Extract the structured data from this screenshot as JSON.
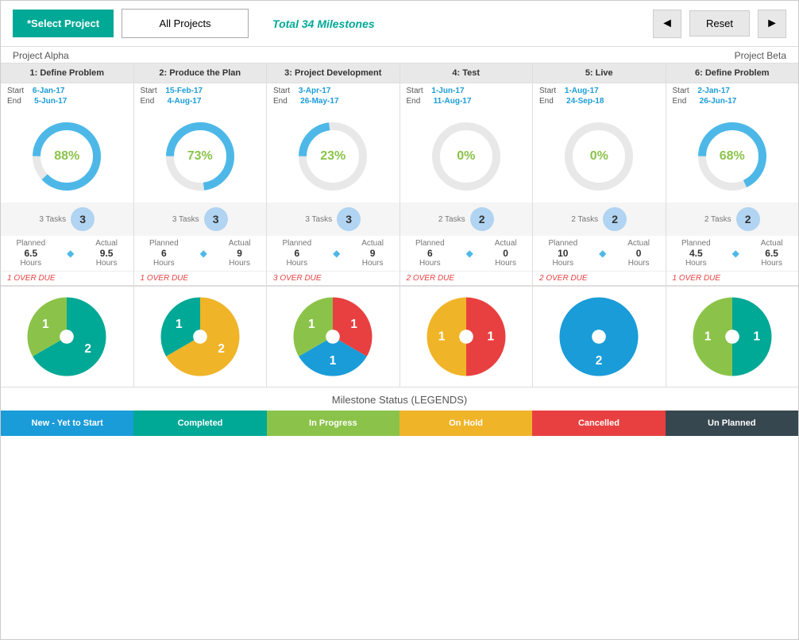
{
  "header": {
    "select_label": "*Select Project",
    "all_projects_label": "All Projects",
    "total_milestones": "Total 34 Milestones",
    "reset_label": "Reset",
    "prev_icon": "◄",
    "next_icon": "►"
  },
  "project_labels": {
    "left": "Project Alpha",
    "right": "Project Beta"
  },
  "phases": [
    {
      "id": 1,
      "name": "1: Define Problem",
      "start": "6-Jan-17",
      "end": "5-Jun-17",
      "percent": "88%",
      "pct_value": 88,
      "tasks": "3 Tasks",
      "tasks_count": "3",
      "planned_hours": "6.5",
      "actual_hours": "9.5",
      "overdue": "1 OVER DUE"
    },
    {
      "id": 2,
      "name": "2: Produce the Plan",
      "start": "15-Feb-17",
      "end": "4-Aug-17",
      "percent": "73%",
      "pct_value": 73,
      "tasks": "3 Tasks",
      "tasks_count": "3",
      "planned_hours": "6",
      "actual_hours": "9",
      "overdue": "1 OVER DUE"
    },
    {
      "id": 3,
      "name": "3: Project Development",
      "start": "3-Apr-17",
      "end": "26-May-17",
      "percent": "23%",
      "pct_value": 23,
      "tasks": "3 Tasks",
      "tasks_count": "3",
      "planned_hours": "6",
      "actual_hours": "9",
      "overdue": "3 OVER DUE"
    },
    {
      "id": 4,
      "name": "4: Test",
      "start": "1-Jun-17",
      "end": "11-Aug-17",
      "percent": "0%",
      "pct_value": 0,
      "tasks": "2 Tasks",
      "tasks_count": "2",
      "planned_hours": "6",
      "actual_hours": "0",
      "overdue": "2 OVER DUE"
    },
    {
      "id": 5,
      "name": "5: Live",
      "start": "1-Aug-17",
      "end": "24-Sep-18",
      "percent": "0%",
      "pct_value": 0,
      "tasks": "2 Tasks",
      "tasks_count": "2",
      "planned_hours": "10",
      "actual_hours": "0",
      "overdue": "2 OVER DUE"
    },
    {
      "id": 6,
      "name": "6: Define Problem",
      "start": "2-Jan-17",
      "end": "26-Jun-17",
      "percent": "68%",
      "pct_value": 68,
      "tasks": "2 Tasks",
      "tasks_count": "2",
      "planned_hours": "4.5",
      "actual_hours": "6.5",
      "overdue": "1 OVER DUE"
    }
  ],
  "legend": [
    {
      "label": "New - Yet to Start",
      "color": "#1a9cd8"
    },
    {
      "label": "Completed",
      "color": "#00a896"
    },
    {
      "label": "In Progress",
      "color": "#8bc34a"
    },
    {
      "label": "On Hold",
      "color": "#f0b429"
    },
    {
      "label": "Cancelled",
      "color": "#e84040"
    },
    {
      "label": "Un Planned",
      "color": "#37474f"
    }
  ],
  "milestone_status_title": "Milestone Status (LEGENDS)"
}
